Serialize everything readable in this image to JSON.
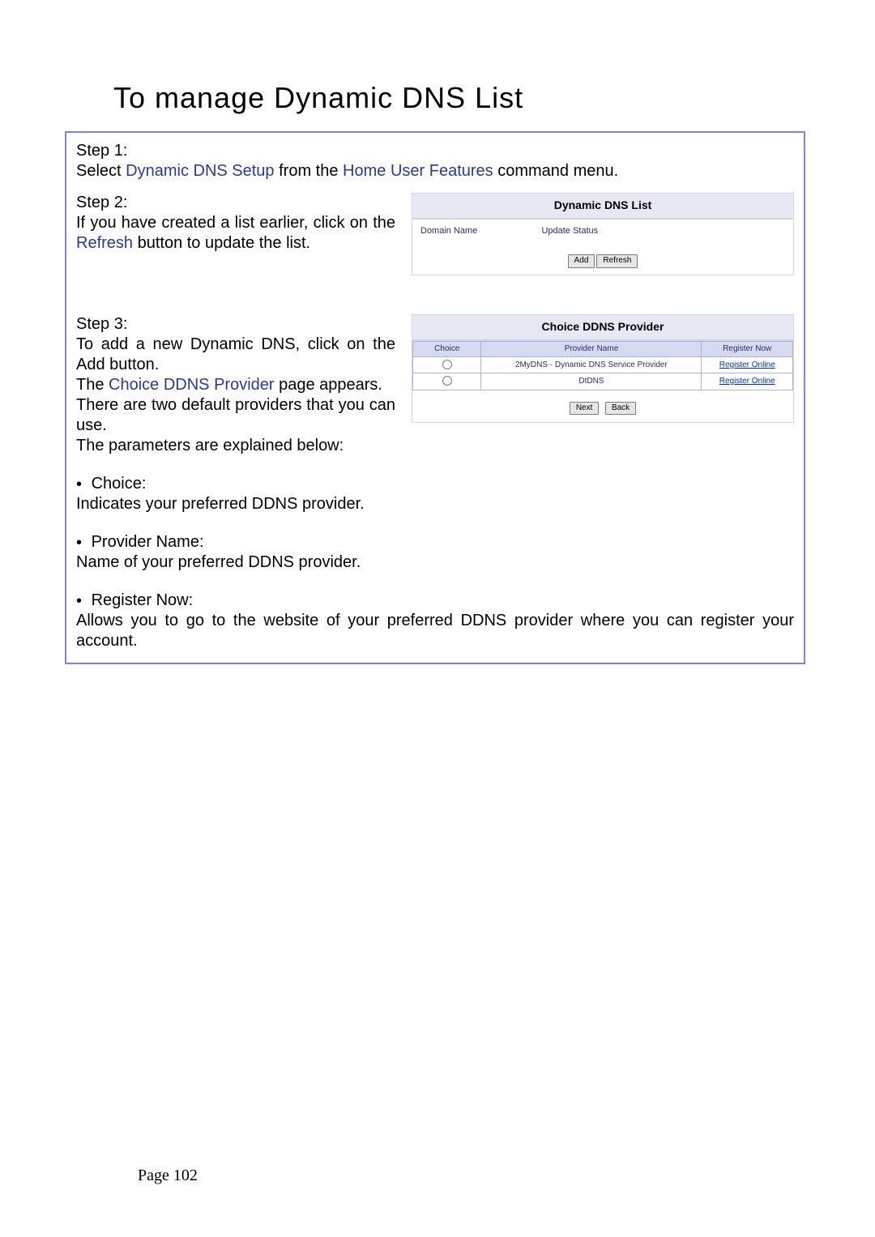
{
  "title": "To manage Dynamic DNS List",
  "step1": {
    "label": "Step 1:",
    "pre": "Select ",
    "link": "Dynamic DNS Setup",
    "mid": " from the ",
    "link2": "Home User Features",
    "post": " command menu."
  },
  "step2": {
    "label": "Step 2:",
    "line1": "If you have created a list earlier, click on the ",
    "refresh": "Refresh",
    "line2": " button to update the list."
  },
  "panel1": {
    "title": "Dynamic DNS List",
    "col1": "Domain Name",
    "col2": "Update Status",
    "btn_add": "Add",
    "btn_refresh": "Refresh"
  },
  "step3": {
    "label": "Step 3:",
    "line1": "To add a new Dynamic DNS, click on the Add button.",
    "line2_pre": "The ",
    "line2_link": "Choice DDNS Provider",
    "line2_post": " page appears.",
    "line3": "There are two default providers that you can use.",
    "line4": "The parameters are explained below:"
  },
  "panel2": {
    "title": "Choice DDNS Provider",
    "headers": {
      "c1": "Choice",
      "c2": "Provider Name",
      "c3": "Register Now"
    },
    "rows": [
      {
        "provider": "2MyDNS - Dynamic DNS Service Provider",
        "reg": "Register Online"
      },
      {
        "provider": "DtDNS",
        "reg": "Register Online"
      }
    ],
    "btn_next": "Next",
    "btn_back": "Back"
  },
  "params": {
    "choice": {
      "title": "Choice:",
      "desc": "Indicates your preferred DDNS provider."
    },
    "provider": {
      "title": "Provider Name:",
      "desc": "Name of your preferred DDNS provider."
    },
    "register": {
      "title": "Register Now:",
      "desc": "Allows you to go to the website of your preferred DDNS provider where you can register your account."
    }
  },
  "footer": "Page 102"
}
